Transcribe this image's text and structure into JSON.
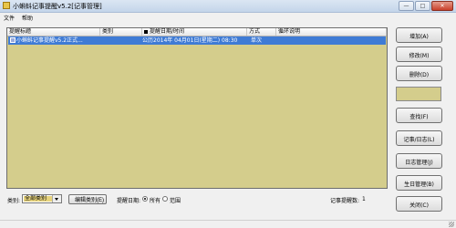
{
  "window": {
    "title": "小蝌蚪记事提醒v5.2[记事管理]",
    "controls": [
      "—",
      "□",
      "✕"
    ]
  },
  "menu": [
    "文件",
    "帮助"
  ],
  "list": {
    "columns": [
      "提醒标题",
      "类别",
      "提醒日期/时间",
      "方式",
      "循环说明"
    ],
    "rows": [
      {
        "title": "小蝌蚪记事提醒v5.2正式...",
        "category": "",
        "datetime": "公历2014年 04月01日(星期二) 08:30",
        "method": "单次",
        "cycle": ""
      }
    ],
    "bg_color": "#d4cd8c",
    "selected_color": "#3f7bd5"
  },
  "sidebar": {
    "add": "增加(A)",
    "edit": "修改(M)",
    "delete": "删除(D)",
    "find": "查找(F)",
    "notes_log": "记事/日志(L)",
    "log_manage": "日志管理(J)",
    "birthday": "生日管理(B)",
    "close": "关闭(C)"
  },
  "bottom": {
    "category_label": "类别:",
    "category_value": "全部类别",
    "edit_category": "编辑类别(E)",
    "date_label": "提醒日期:",
    "radio_all": "所有",
    "radio_range": "范围",
    "count_label": "记事提醒数:",
    "count_value": "1"
  }
}
